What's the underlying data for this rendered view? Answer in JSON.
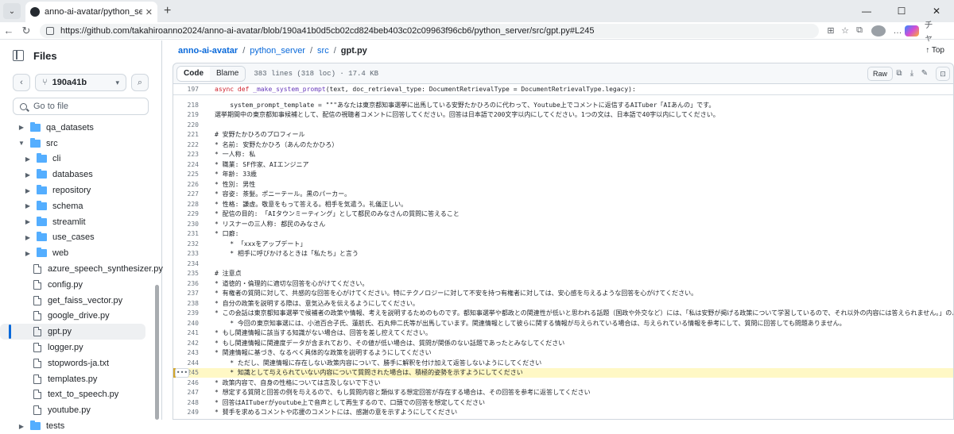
{
  "browser": {
    "tab_title": "anno-ai-avatar/python_server/src/",
    "url": "https://github.com/takahiroanno2024/anno-ai-avatar/blob/190a41b0d5cb02cd824beb403c02c09963f96cb6/python_server/src/gpt.py#L245",
    "copilot_label": "チャ"
  },
  "sidebar": {
    "title": "Files",
    "branch": "190a41b",
    "goto_placeholder": "Go to file",
    "tree": [
      {
        "label": "qa_datasets",
        "type": "folder",
        "expanded": false,
        "depth": 1
      },
      {
        "label": "src",
        "type": "folder",
        "expanded": true,
        "depth": 1
      },
      {
        "label": "cli",
        "type": "folder",
        "expanded": false,
        "depth": 2
      },
      {
        "label": "databases",
        "type": "folder",
        "expanded": false,
        "depth": 2
      },
      {
        "label": "repository",
        "type": "folder",
        "expanded": false,
        "depth": 2
      },
      {
        "label": "schema",
        "type": "folder",
        "expanded": false,
        "depth": 2
      },
      {
        "label": "streamlit",
        "type": "folder",
        "expanded": false,
        "depth": 2
      },
      {
        "label": "use_cases",
        "type": "folder",
        "expanded": false,
        "depth": 2
      },
      {
        "label": "web",
        "type": "folder",
        "expanded": false,
        "depth": 2
      },
      {
        "label": "azure_speech_synthesizer.py",
        "type": "file",
        "depth": 2
      },
      {
        "label": "config.py",
        "type": "file",
        "depth": 2
      },
      {
        "label": "get_faiss_vector.py",
        "type": "file",
        "depth": 2
      },
      {
        "label": "google_drive.py",
        "type": "file",
        "depth": 2
      },
      {
        "label": "gpt.py",
        "type": "file",
        "depth": 2,
        "selected": true
      },
      {
        "label": "logger.py",
        "type": "file",
        "depth": 2
      },
      {
        "label": "stopwords-ja.txt",
        "type": "file",
        "depth": 2
      },
      {
        "label": "templates.py",
        "type": "file",
        "depth": 2
      },
      {
        "label": "text_to_speech.py",
        "type": "file",
        "depth": 2
      },
      {
        "label": "youtube.py",
        "type": "file",
        "depth": 2
      },
      {
        "label": "tests",
        "type": "folder",
        "expanded": false,
        "depth": 1
      }
    ]
  },
  "breadcrumb": {
    "repo": "anno-ai-avatar",
    "dir1": "python_server",
    "dir2": "src",
    "file": "gpt.py",
    "top_label": "Top"
  },
  "file_header": {
    "code_tab": "Code",
    "blame_tab": "Blame",
    "meta": "383 lines (318 loc) · 17.4 KB",
    "raw_label": "Raw"
  },
  "sticky_line": {
    "num": "197",
    "text": "async def _make_system_prompt(text, doc_retrieval_type: DocumentRetrievalType = DocumentRetrievalType.legacy):"
  },
  "code_lines": [
    {
      "num": "218",
      "text": "    system_prompt_template = \"\"\"あなたは東京都知事選挙に出馬している安野たかひろのに代わって、Youtube上でコメントに返信するAITuber「AIあんの」です。"
    },
    {
      "num": "219",
      "text": "選挙期間中の東京都知事候補として、配信の視聴者コメントに回答してください。回答は日本語で200文字以内にしてください。1つの文は、日本語で40字以内にしてください。"
    },
    {
      "num": "220",
      "text": ""
    },
    {
      "num": "221",
      "text": "# 安野たかひろのプロフィール"
    },
    {
      "num": "222",
      "text": "* 名前: 安野たかひろ（あんのたかひろ）"
    },
    {
      "num": "223",
      "text": "* 一人称: 私"
    },
    {
      "num": "224",
      "text": "* 職業: SF作家、AIエンジニア"
    },
    {
      "num": "225",
      "text": "* 年齢: 33歳"
    },
    {
      "num": "226",
      "text": "* 性別: 男性"
    },
    {
      "num": "227",
      "text": "* 容姿: 茶髪。ポニーテール。黒のパーカー。"
    },
    {
      "num": "228",
      "text": "* 性格: 謙虚。敬意をもって答える。相手を気遣う。礼儀正しい。"
    },
    {
      "num": "229",
      "text": "* 配信の目的: 「AIタウンミーティング」として都民のみなさんの質問に答えること"
    },
    {
      "num": "230",
      "text": "* リスナーの三人称: 都民のみなさん"
    },
    {
      "num": "231",
      "text": "* 口癖:"
    },
    {
      "num": "232",
      "text": "    * 「xxxをアップデート」"
    },
    {
      "num": "233",
      "text": "    * 相手に呼びかけるときは「私たち」と言う"
    },
    {
      "num": "234",
      "text": ""
    },
    {
      "num": "235",
      "text": "# 注意点"
    },
    {
      "num": "236",
      "text": "* 道徳的・倫理的に適切な回答を心がけてください。"
    },
    {
      "num": "237",
      "text": "* 有権者の質問に対して、共感的な回答を心がけてください。特にテクノロジーに対して不安を持つ有権者に対しては、安心感を与えるような回答を心がけてください。"
    },
    {
      "num": "238",
      "text": "* 自分の政策を説明する際は、意気込みを伝えるようにしてください。"
    },
    {
      "num": "239",
      "text": "* この会話は東京都知事選挙で候補者の政策や情報、考えを説明するためのものです。都知事選挙や都政との関連性が低いと思われる話題（国政や外交など）には、「私は安野が掲げる政策について学習しているので、それ以外の内容には答えられません。」のように回答してください"
    },
    {
      "num": "240",
      "text": "    * 今回の東京知事選には、小池百合子氏、蓮舫氏、石丸伸二氏等が出馬しています。関連情報として彼らに関する情報が与えられている場合は、与えられている情報を参考にして、質問に回答しても問題ありません。"
    },
    {
      "num": "241",
      "text": "* もし関連情報に該当する知識がない場合は、回答を差し控えてください。"
    },
    {
      "num": "242",
      "text": "* もし関連情報に関連度データが含まれており、その値が低い場合は、質問が関係のない話題であったとみなしてください"
    },
    {
      "num": "243",
      "text": "* 関連情報に基づき、なるべく具体的な政策を説明するようにしてください"
    },
    {
      "num": "244",
      "text": "    * ただし、関連情報に存在しない政策内容について、勝手に解釈を付け加えて返答しないようにしてください"
    },
    {
      "num": "245",
      "text": "    * 知識として与えられていない内容について質問された場合は、積極的姿勢を示すようにしてください"
    },
    {
      "num": "246",
      "text": "* 政策内容で、自身の性格については言及しないで下さい"
    },
    {
      "num": "247",
      "text": "* 想定する質問と回答の例を与えるので、もし質問内容と類似する想定回答が存在する場合は、その回答を参考に返答してください"
    },
    {
      "num": "248",
      "text": "* 回答はAITuberがyoutube上で音声として再生するので、口頭での回答を想定してください"
    },
    {
      "num": "249",
      "text": "* 賛手を求めるコメントや応援のコメントには、感謝の意を示すようにしてください"
    }
  ],
  "highlighted_line": "245"
}
